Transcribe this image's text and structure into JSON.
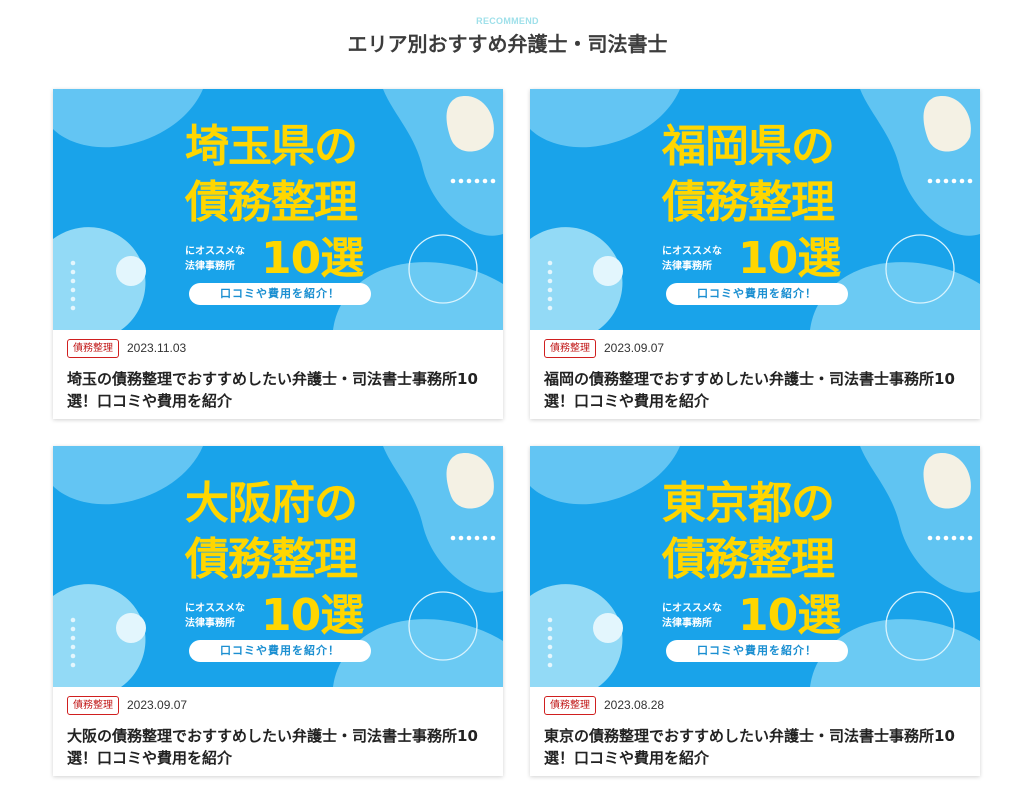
{
  "section": {
    "eyebrow": "RECOMMEND",
    "heading": "エリア別おすすめ弁護士・司法書士"
  },
  "colors": {
    "thumb_bg": "#19a3ea",
    "title_yellow": "#ffd600",
    "tag_red": "#c11818"
  },
  "cards": [
    {
      "thumb": {
        "line1": "埼玉県の",
        "line2": "債務整理",
        "sub1": "にオススメな",
        "sub2": "法律事務所",
        "number": "10選",
        "pill": "口コミや費用を紹介！"
      },
      "tag": "債務整理",
      "date": "2023.11.03",
      "title": "埼玉の債務整理でおすすめしたい弁護士・司法書士事務所10選！口コミや費用を紹介"
    },
    {
      "thumb": {
        "line1": "福岡県の",
        "line2": "債務整理",
        "sub1": "にオススメな",
        "sub2": "法律事務所",
        "number": "10選",
        "pill": "口コミや費用を紹介！"
      },
      "tag": "債務整理",
      "date": "2023.09.07",
      "title": "福岡の債務整理でおすすめしたい弁護士・司法書士事務所10選！口コミや費用を紹介"
    },
    {
      "thumb": {
        "line1": "大阪府の",
        "line2": "債務整理",
        "sub1": "にオススメな",
        "sub2": "法律事務所",
        "number": "10選",
        "pill": "口コミや費用を紹介！"
      },
      "tag": "債務整理",
      "date": "2023.09.07",
      "title": "大阪の債務整理でおすすめしたい弁護士・司法書士事務所10選！口コミや費用を紹介"
    },
    {
      "thumb": {
        "line1": "東京都の",
        "line2": "債務整理",
        "sub1": "にオススメな",
        "sub2": "法律事務所",
        "number": "10選",
        "pill": "口コミや費用を紹介！"
      },
      "tag": "債務整理",
      "date": "2023.08.28",
      "title": "東京の債務整理でおすすめしたい弁護士・司法書士事務所10選！口コミや費用を紹介"
    }
  ]
}
